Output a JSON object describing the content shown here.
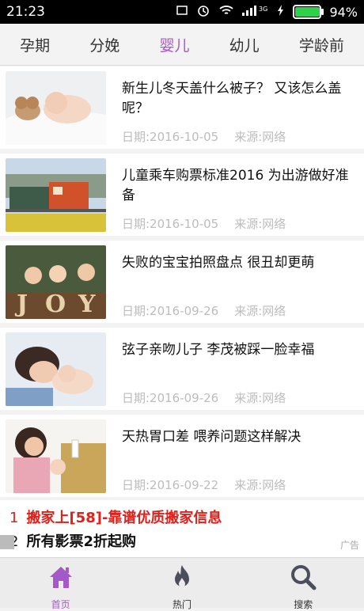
{
  "status_bar": {
    "time": "21:23",
    "network": "3G",
    "battery": "94%",
    "battery_level": 0.94
  },
  "tabs": [
    {
      "label": "孕期",
      "active": false
    },
    {
      "label": "分娩",
      "active": false
    },
    {
      "label": "婴儿",
      "active": true
    },
    {
      "label": "幼儿",
      "active": false
    },
    {
      "label": "学龄前",
      "active": false
    }
  ],
  "articles": [
    {
      "title": "新生儿冬天盖什么被子？ 又该怎么盖呢？",
      "date": "日期:2016-10-05",
      "source": "来源:网络"
    },
    {
      "title": "儿童乘车购票标准2016 为出游做好准备",
      "date": "日期:2016-10-05",
      "source": "来源:网络"
    },
    {
      "title": "失败的宝宝拍照盘点 很丑却更萌",
      "date": "日期:2016-09-26",
      "source": "来源:网络"
    },
    {
      "title": "弦子亲吻儿子 李茂被踩一脸幸福",
      "date": "日期:2016-09-26",
      "source": "来源:网络"
    },
    {
      "title": "天热胃口差 喂养问题这样解决",
      "date": "日期:2016-09-22",
      "source": "来源:网络"
    }
  ],
  "ads": {
    "items": [
      {
        "num": "1",
        "text": "搬家上[58]-靠谱优质搬家信息"
      },
      {
        "num": "2",
        "text": "所有影票2折起购"
      }
    ],
    "label": "广告"
  },
  "bottom_nav": [
    {
      "label": "首页",
      "icon": "home-icon",
      "active": true
    },
    {
      "label": "热门",
      "icon": "flame-icon",
      "active": false
    },
    {
      "label": "搜索",
      "icon": "search-icon",
      "active": false
    }
  ],
  "colors": {
    "accent": "#a558c8",
    "ad_red": "#e0201b",
    "battery_green": "#2fd14a"
  }
}
